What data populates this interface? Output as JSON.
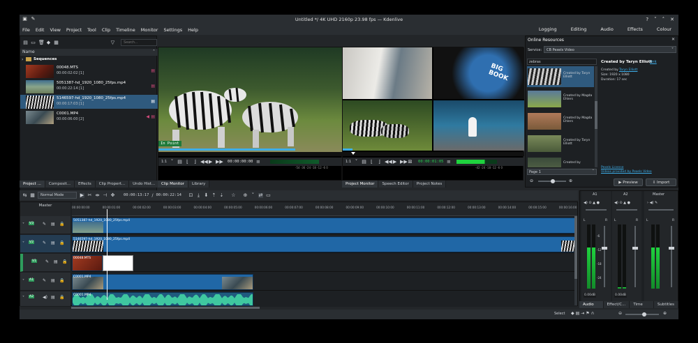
{
  "window": {
    "title": "Untitled */ 4K UHD 2160p 23.98 fps — Kdenlive"
  },
  "menu": [
    "File",
    "Edit",
    "View",
    "Project",
    "Tool",
    "Clip",
    "Timeline",
    "Monitor",
    "Settings",
    "Help"
  ],
  "layouts": [
    "Logging",
    "Editing",
    "Audio",
    "Effects",
    "Colour"
  ],
  "bin": {
    "search_placeholder": "Search...",
    "column_name": "Name",
    "folder": "Sequences",
    "items": [
      {
        "name": "00048.MTS",
        "duration": "00:00:02:02 [1]"
      },
      {
        "name": "5051387-hd_1920_1080_25fps.mp4",
        "duration": "00:00:22:14 [1]"
      },
      {
        "name": "5146597-hd_1920_1080_25fps.mp4",
        "duration": "00:00:17:03 [1]"
      },
      {
        "name": "C0001.MP4",
        "duration": "00:00:06:00 [2]"
      }
    ],
    "tabs": [
      "Project ...",
      "Composit...",
      "Effects",
      "Clip Propert...",
      "Undo Hist..."
    ]
  },
  "clip_monitor": {
    "in_point": "In Point",
    "zoom": "1:1",
    "timecode": "00:00:00:00",
    "tabs": [
      "Clip Monitor",
      "Library"
    ],
    "scale": "-54 -36 -24 -18 -12 -6 0"
  },
  "project_monitor": {
    "zoom": "1:1",
    "timecode": "00:00:01:05",
    "tabs": [
      "Project Monitor",
      "Speech Editor",
      "Project Notes"
    ],
    "scale": "-42 -24 -18 -12 -6 0"
  },
  "online_resources": {
    "title": "Online Resources",
    "service_label": "Service:",
    "service": "CB Pexels Video",
    "query": "zebras",
    "results": [
      {
        "label": "Created by Taryn Elliott"
      },
      {
        "label": "Created by Magda Ehlers"
      },
      {
        "label": "Created by Magda Ehlers"
      },
      {
        "label": "Created by Taryn Elliott"
      },
      {
        "label": "Created by"
      }
    ],
    "details_title": "Created by Taryn Elliott",
    "details_link": "link",
    "details_author_prefix": "Created by ",
    "details_author": "Taryn Elliott",
    "details_size": "Size: 1920 x 1080",
    "details_duration": "Duration: 17 sec",
    "page": "Page 1",
    "license": "Pexels License",
    "provided": "Videos provided by Pexels Video",
    "preview": "Preview",
    "import": "Import"
  },
  "timeline": {
    "mode": "Normal Mode",
    "position": "00:00:13:17",
    "duration": "00:00:22:14",
    "master_label": "Master",
    "ruler": [
      "00:00:00:00",
      "00:00:01:00",
      "00:00:02:00",
      "00:00:03:00",
      "00:00:04:00",
      "00:00:05:00",
      "00:00:06:00",
      "00:00:07:00",
      "00:00:08:00",
      "00:00:09:00",
      "00:00:10:00",
      "00:00:11:00",
      "00:00:12:00",
      "00:00:13:00",
      "00:00:14:00",
      "00:00:15:00",
      "00:00:16:00"
    ],
    "tracks": [
      {
        "tag": "V3",
        "clips": [
          {
            "label": "5051387-hd_1920_1080_25fps.mp4"
          }
        ]
      },
      {
        "tag": "V2",
        "clips": [
          {
            "label": "5146597-hd_1920_1080_25fps.mp4"
          }
        ]
      },
      {
        "tag": "V1",
        "clips": [
          {
            "label": "00048.MTS"
          }
        ]
      },
      {
        "tag": "A1",
        "clips": [
          {
            "label": "C0001.MP4"
          }
        ]
      },
      {
        "tag": "A2",
        "clips": [
          {
            "label": "C0001.MP4"
          }
        ]
      }
    ]
  },
  "mixer": {
    "channels": [
      {
        "name": "A1",
        "level": "0.00dB"
      },
      {
        "name": "A2",
        "level": "0.00dB"
      },
      {
        "name": "Master",
        "level": ""
      }
    ],
    "scale": [
      "-6",
      "-12",
      "-18",
      "-24"
    ],
    "tabs": [
      "Audio M...",
      "Effect/C...",
      "Time Re...",
      "Subtitles"
    ]
  },
  "statusbar": {
    "select": "Select"
  },
  "colors": {
    "accent": "#3daee9",
    "clip": "#2067a6",
    "audio_wave": "#3fc7a0",
    "meter_green": "#1fd23e",
    "track_active": "#2e9c5c"
  }
}
